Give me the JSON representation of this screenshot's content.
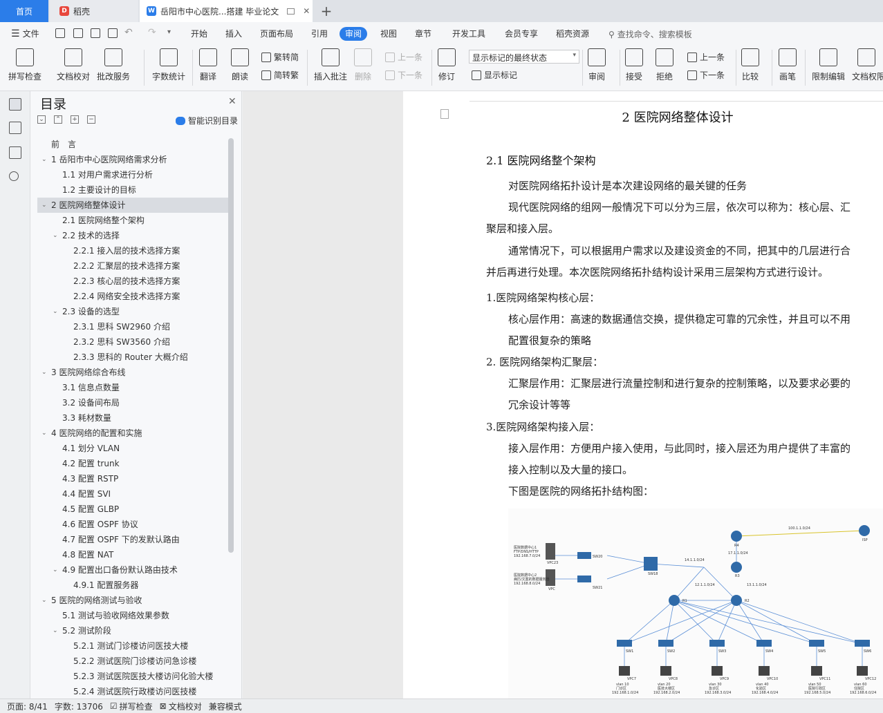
{
  "tabs": {
    "home": "首页",
    "daoke": "稻壳",
    "doc": "岳阳市中心医院...搭建 毕业论文",
    "plus": "+"
  },
  "menubar": {
    "file": "文件",
    "items": [
      "开始",
      "插入",
      "页面布局",
      "引用",
      "审阅",
      "视图",
      "章节",
      "开发工具",
      "会员专享",
      "稻壳资源"
    ],
    "active": "审阅",
    "search": "查找命令、搜索模板"
  },
  "ribbon": {
    "spell": "拼写检查",
    "proof": "文档校对",
    "batch": "批改服务",
    "wordcount": "字数统计",
    "translate": "翻译",
    "read": "朗读",
    "t2s": "繁转简",
    "s2t": "简转繁",
    "insert_comment": "插入批注",
    "delete": "删除",
    "prev_comment": "上一条",
    "next_comment": "下一条",
    "revise": "修订",
    "markup_state": "显示标记的最终状态",
    "show_markup": "显示标记",
    "review": "审阅",
    "accept": "接受",
    "reject": "拒绝",
    "prev": "上一条",
    "next": "下一条",
    "compare": "比较",
    "pen": "画笔",
    "restrict": "限制编辑",
    "docperm": "文档权限"
  },
  "toc": {
    "title": "目录",
    "smart": "智能识别目录",
    "items": [
      {
        "text": "前　言",
        "lvl": 0,
        "arr": ""
      },
      {
        "text": "1 岳阳市中心医院网络需求分析",
        "lvl": 0,
        "arr": "v"
      },
      {
        "text": "1.1 对用户需求进行分析",
        "lvl": 1,
        "arr": ""
      },
      {
        "text": "1.2 主要设计的目标",
        "lvl": 1,
        "arr": ""
      },
      {
        "text": "2 医院网络整体设计",
        "lvl": 0,
        "arr": "v",
        "sel": true
      },
      {
        "text": "2.1 医院网络整个架构",
        "lvl": 1,
        "arr": ""
      },
      {
        "text": "2.2 技术的选择",
        "lvl": 1,
        "arr": "v"
      },
      {
        "text": "2.2.1 接入层的技术选择方案",
        "lvl": 2,
        "arr": ""
      },
      {
        "text": "2.2.2 汇聚层的技术选择方案",
        "lvl": 2,
        "arr": ""
      },
      {
        "text": "2.2.3 核心层的技术选择方案",
        "lvl": 2,
        "arr": ""
      },
      {
        "text": "2.2.4 网络安全技术选择方案",
        "lvl": 2,
        "arr": ""
      },
      {
        "text": "2.3 设备的选型",
        "lvl": 1,
        "arr": "v"
      },
      {
        "text": "2.3.1 思科 SW2960 介绍",
        "lvl": 2,
        "arr": ""
      },
      {
        "text": "2.3.2 思科 SW3560 介绍",
        "lvl": 2,
        "arr": ""
      },
      {
        "text": "2.3.3 思科的 Router 大概介绍",
        "lvl": 2,
        "arr": ""
      },
      {
        "text": "3 医院网络综合布线",
        "lvl": 0,
        "arr": "v"
      },
      {
        "text": "3.1 信息点数量",
        "lvl": 1,
        "arr": ""
      },
      {
        "text": "3.2 设备间布局",
        "lvl": 1,
        "arr": ""
      },
      {
        "text": "3.3 耗材数量",
        "lvl": 1,
        "arr": ""
      },
      {
        "text": "4 医院网络的配置和实施",
        "lvl": 0,
        "arr": "v"
      },
      {
        "text": "4.1 划分 VLAN",
        "lvl": 1,
        "arr": ""
      },
      {
        "text": "4.2 配置 trunk",
        "lvl": 1,
        "arr": ""
      },
      {
        "text": "4.3 配置 RSTP",
        "lvl": 1,
        "arr": ""
      },
      {
        "text": "4.4 配置 SVI",
        "lvl": 1,
        "arr": ""
      },
      {
        "text": "4.5 配置 GLBP",
        "lvl": 1,
        "arr": ""
      },
      {
        "text": "4.6 配置 OSPF 协议",
        "lvl": 1,
        "arr": ""
      },
      {
        "text": "4.7 配置 OSPF 下的发默认路由",
        "lvl": 1,
        "arr": ""
      },
      {
        "text": "4.8 配置 NAT",
        "lvl": 1,
        "arr": ""
      },
      {
        "text": "4.9 配置出口备份默认路由技术",
        "lvl": 1,
        "arr": "v"
      },
      {
        "text": "4.9.1 配置服务器",
        "lvl": 2,
        "arr": ""
      },
      {
        "text": "5 医院的网络测试与验收",
        "lvl": 0,
        "arr": "v"
      },
      {
        "text": "5.1 测试与验收网络效果参数",
        "lvl": 1,
        "arr": ""
      },
      {
        "text": "5.2 测试阶段",
        "lvl": 1,
        "arr": "v"
      },
      {
        "text": "5.2.1 测试门诊楼访问医技大楼",
        "lvl": 2,
        "arr": ""
      },
      {
        "text": "5.2.2 测试医院门诊楼访问急诊楼",
        "lvl": 2,
        "arr": ""
      },
      {
        "text": "5.2.3 测试医院医技大楼访问化验大楼",
        "lvl": 2,
        "arr": ""
      },
      {
        "text": "5.2.4 测试医院行政楼访问医技楼",
        "lvl": 2,
        "arr": ""
      }
    ]
  },
  "doc": {
    "h1": "2 医院网络整体设计",
    "h2": "2.1 医院网络整个架构",
    "lines": [
      "对医院网络拓扑设计是本次建设网络的最关键的任务",
      "现代医院网络的组网一般情况下可以分为三层，依次可以称为：核心层、汇",
      "聚层和接入层。",
      "通常情况下，可以根据用户需求以及建设资金的不同，把其中的几层进行合",
      "并后再进行处理。本次医院网络拓扑结构设计采用三层架构方式进行设计。",
      "1.医院网络架构核心层：",
      "核心层作用：高速的数据通信交换，提供稳定可靠的冗余性，并且可以不用",
      "配置很复杂的策略",
      "2. 医院网络架构汇聚层：",
      "汇聚层作用：汇聚层进行流量控制和进行复杂的控制策略，以及要求必要的",
      "冗余设计等等",
      "3.医院网络架构接入层：",
      "接入层作用：方便用户接入使用，与此同时，接入层还为用户提供了丰富的",
      "接入控制以及大量的接口。",
      "下图是医院的网络拓扑结构图："
    ]
  },
  "topology": {
    "isp_link": "100.1.1.0/24",
    "r4": "R4",
    "isp": "ISP",
    "r4_net": "17.1.1.0/24",
    "core_link": "14.1.1.0/24",
    "r3": "R3",
    "r3_left": "12.1.1.0/24",
    "r3_right": "13.1.1.0/24",
    "r1": "R1",
    "r2": "R2",
    "sw18": "SW18",
    "sw20": "SW20",
    "sw21": "SW21",
    "vpc23": "VPC23",
    "vpc": "VPC",
    "server1": "医院数据中心1",
    "server1_b": "FTP/DNS/HTTP",
    "server1_ip": "192.168.7.0/24",
    "server2": "医院数据中心2",
    "server2_b": "病历/文案的数据服务器",
    "server2_ip": "192.168.8.0/24",
    "switches": [
      "SW1",
      "SW2",
      "SW3",
      "SW4",
      "SW5",
      "SW6"
    ],
    "vpcs": [
      "VPC7",
      "VPC8",
      "VPC9",
      "VPC10",
      "VPC11",
      "VPC12"
    ],
    "vlans": [
      "vlan 10",
      "vlan 20",
      "vlan 30",
      "vlan 40",
      "vlan 50",
      "vlan 60"
    ],
    "areas": [
      "门诊区",
      "医技大楼区",
      "急诊区",
      "化验区",
      "医院行政区",
      "住院区"
    ],
    "nets": [
      "192.168.1.0/24",
      "192.168.2.0/24",
      "192.168.3.0/24",
      "192.168.4.0/24",
      "192.168.5.0/24",
      "192.168.6.0/24"
    ]
  },
  "status": {
    "page": "页面: 8/41",
    "words": "字数: 13706",
    "spell": "拼写检查",
    "proof": "文档校对",
    "compat": "兼容模式"
  }
}
